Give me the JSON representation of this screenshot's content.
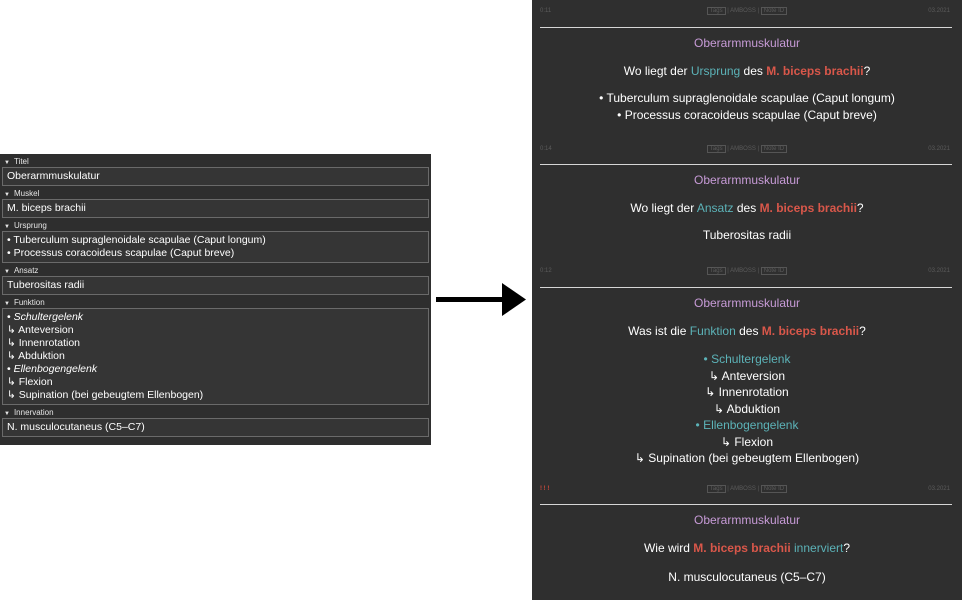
{
  "editor": {
    "fields": [
      {
        "label": "Titel",
        "lines": [
          "Oberarmmuskulatur"
        ]
      },
      {
        "label": "Muskel",
        "lines": [
          "M. biceps brachii"
        ]
      },
      {
        "label": "Ursprung",
        "lines": [
          "• Tuberculum supraglenoidale scapulae (Caput longum)",
          "• Processus coracoideus scapulae (Caput breve)"
        ]
      },
      {
        "label": "Ansatz",
        "lines": [
          "Tuberositas radii"
        ]
      },
      {
        "label": "Funktion",
        "lines": [
          "• ",
          "Schultergelenk",
          "↳ Anteversion",
          "↳ Innenrotation",
          "↳ Abduktion",
          "• ",
          "Ellenbogengelenk",
          "↳ Flexion",
          "↳ Supination (bei gebeugtem Ellenbogen)"
        ]
      },
      {
        "label": "Innervation",
        "lines": [
          "N. musculocutaneus (C5–C7)"
        ]
      }
    ]
  },
  "meta_common": {
    "tags": "Tags",
    "source": "AMBOSS",
    "note_id": "Note ID",
    "date": "03.2021"
  },
  "cards": [
    {
      "time": "0:11",
      "title": "Oberarmmuskulatur",
      "q_pre": "Wo liegt der ",
      "q_key": "Ursprung",
      "q_mid": " des ",
      "q_muscle": "M. biceps brachii",
      "q_post": "?",
      "answers": [
        "• Tuberculum supraglenoidale scapulae (Caput longum)",
        "• Processus coracoideus scapulae (Caput breve)"
      ]
    },
    {
      "time": "0:14",
      "title": "Oberarmmuskulatur",
      "q_pre": "Wo liegt der ",
      "q_key": "Ansatz",
      "q_mid": " des ",
      "q_muscle": "M. biceps brachii",
      "q_post": "?",
      "answers": [
        "Tuberositas radii"
      ]
    },
    {
      "time": "0:12",
      "title": "Oberarmmuskulatur",
      "q_pre": "Was ist die ",
      "q_key": "Funktion",
      "q_mid": " des ",
      "q_muscle": "M. biceps brachii",
      "q_post": "?",
      "answers": [
        "• ",
        "Schultergelenk",
        "↳ Anteversion",
        "↳ Innenrotation",
        "↳ Abduktion",
        "• ",
        "Ellenbogengelenk",
        "↳ Flexion",
        "↳ Supination (bei gebeugtem Ellenbogen)"
      ]
    },
    {
      "time": "! ! !",
      "title": "Oberarmmuskulatur",
      "q_pre": "Wie wird ",
      "q_muscle": "M. biceps brachii",
      "q_key": "innerviert",
      "q_post": "?",
      "answers": [
        "N. musculocutaneus (C5–C7)"
      ]
    }
  ]
}
